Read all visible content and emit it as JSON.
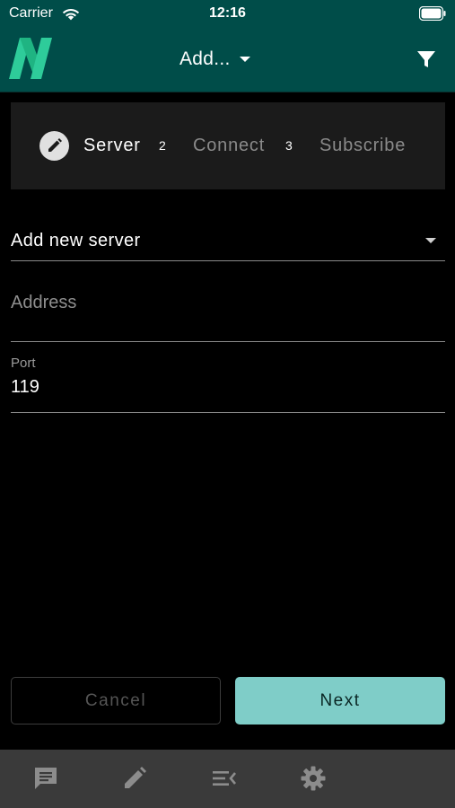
{
  "status_bar": {
    "carrier": "Carrier",
    "time": "12:16"
  },
  "app_bar": {
    "title": "Add...",
    "logo": "n-logo-icon",
    "filter_icon": "filter-icon"
  },
  "stepper": {
    "steps": [
      {
        "label": "Server",
        "icon": "pencil-icon",
        "active": true
      },
      {
        "number": "2",
        "label": "Connect",
        "active": false
      },
      {
        "number": "3",
        "label": "Subscribe",
        "active": false
      }
    ]
  },
  "form": {
    "server_select": {
      "value": "Add new server"
    },
    "address": {
      "placeholder": "Address",
      "value": ""
    },
    "port": {
      "label": "Port",
      "value": "119"
    }
  },
  "buttons": {
    "cancel": "Cancel",
    "next": "Next"
  },
  "bottom_nav": {
    "items": [
      {
        "icon": "message-icon"
      },
      {
        "icon": "pencil-icon"
      },
      {
        "icon": "list-collapse-icon"
      },
      {
        "icon": "gear-icon"
      }
    ]
  },
  "colors": {
    "header": "#004d49",
    "accent": "#7fcdc8",
    "logo": "#2ecc9a",
    "stepper_bg": "#1b1b1b",
    "nav_bg": "#3a3a3a"
  }
}
